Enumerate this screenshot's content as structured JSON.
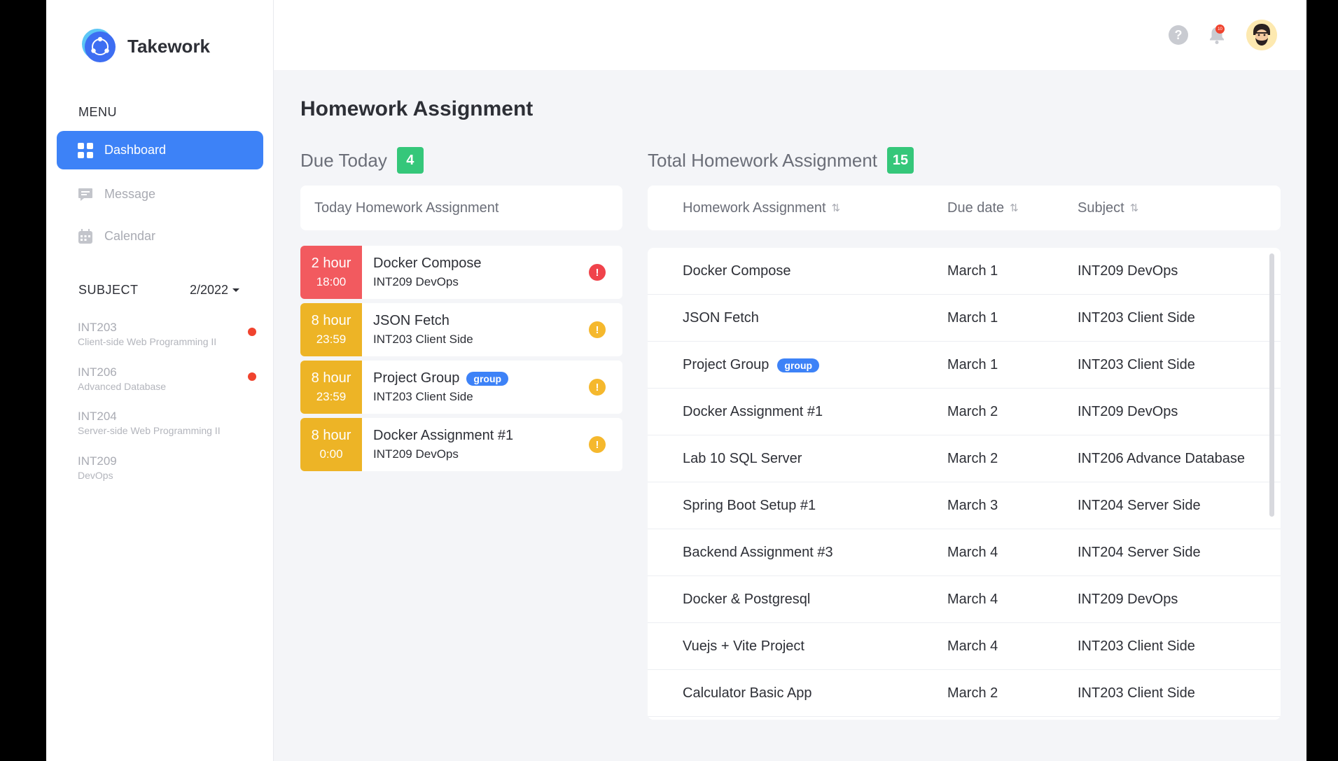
{
  "app": {
    "name": "Takework"
  },
  "sidebar": {
    "menu_label": "MENU",
    "items": [
      {
        "label": "Dashboard",
        "icon": "grid-icon",
        "active": true
      },
      {
        "label": "Message",
        "icon": "message-icon",
        "active": false
      },
      {
        "label": "Calendar",
        "icon": "calendar-icon",
        "active": false
      }
    ],
    "subject_label": "SUBJECT",
    "term": "2/2022",
    "subjects": [
      {
        "code": "INT203",
        "name": "Client-side Web Programming II",
        "has_alert": true
      },
      {
        "code": "INT206",
        "name": "Advanced Database",
        "has_alert": true
      },
      {
        "code": "INT204",
        "name": "Server-side Web Programming II",
        "has_alert": false
      },
      {
        "code": "INT209",
        "name": "DevOps",
        "has_alert": false
      }
    ]
  },
  "topbar": {
    "notification_count": "10"
  },
  "page": {
    "title": "Homework Assignment"
  },
  "due_today": {
    "title": "Due Today",
    "count": "4",
    "list_header": "Today Homework Assignment",
    "items": [
      {
        "hours": "2 hour",
        "time": "18:00",
        "title": "Docker Compose",
        "subject": "INT209 DevOps",
        "urgency": "red",
        "group": ""
      },
      {
        "hours": "8 hour",
        "time": "23:59",
        "title": "JSON Fetch",
        "subject": "INT203 Client Side",
        "urgency": "yellow",
        "group": ""
      },
      {
        "hours": "8 hour",
        "time": "23:59",
        "title": "Project Group",
        "subject": "INT203 Client Side",
        "urgency": "yellow",
        "group": "group"
      },
      {
        "hours": "8 hour",
        "time": "0:00",
        "title": "Docker Assignment #1",
        "subject": "INT209 DevOps",
        "urgency": "yellow",
        "group": ""
      }
    ]
  },
  "total": {
    "title": "Total Homework Assignment",
    "count": "15",
    "columns": [
      "Homework Assignment",
      "Due date",
      "Subject"
    ],
    "rows": [
      {
        "name": "Docker Compose",
        "group": "",
        "due": "March 1",
        "subject": "INT209 DevOps"
      },
      {
        "name": "JSON Fetch",
        "group": "",
        "due": "March 1",
        "subject": "INT203 Client Side"
      },
      {
        "name": "Project Group",
        "group": "group",
        "due": "March 1",
        "subject": "INT203 Client Side"
      },
      {
        "name": "Docker Assignment #1",
        "group": "",
        "due": "March 2",
        "subject": "INT209 DevOps"
      },
      {
        "name": "Lab 10 SQL Server",
        "group": "",
        "due": "March 2",
        "subject": "INT206 Advance Database"
      },
      {
        "name": "Spring Boot Setup #1",
        "group": "",
        "due": "March 3",
        "subject": "INT204 Server Side"
      },
      {
        "name": "Backend Assignment #3",
        "group": "",
        "due": "March 4",
        "subject": "INT204 Server Side"
      },
      {
        "name": "Docker & Postgresql",
        "group": "",
        "due": "March 4",
        "subject": "INT209 DevOps"
      },
      {
        "name": "Vuejs + Vite Project",
        "group": "",
        "due": "March 4",
        "subject": "INT203 Client Side"
      },
      {
        "name": "Calculator Basic App",
        "group": "",
        "due": "March 2",
        "subject": "INT203 Client Side"
      }
    ]
  },
  "colors": {
    "accent": "#3d82f7",
    "success": "#35c77a",
    "danger": "#f25a5f",
    "warning": "#edb426"
  }
}
